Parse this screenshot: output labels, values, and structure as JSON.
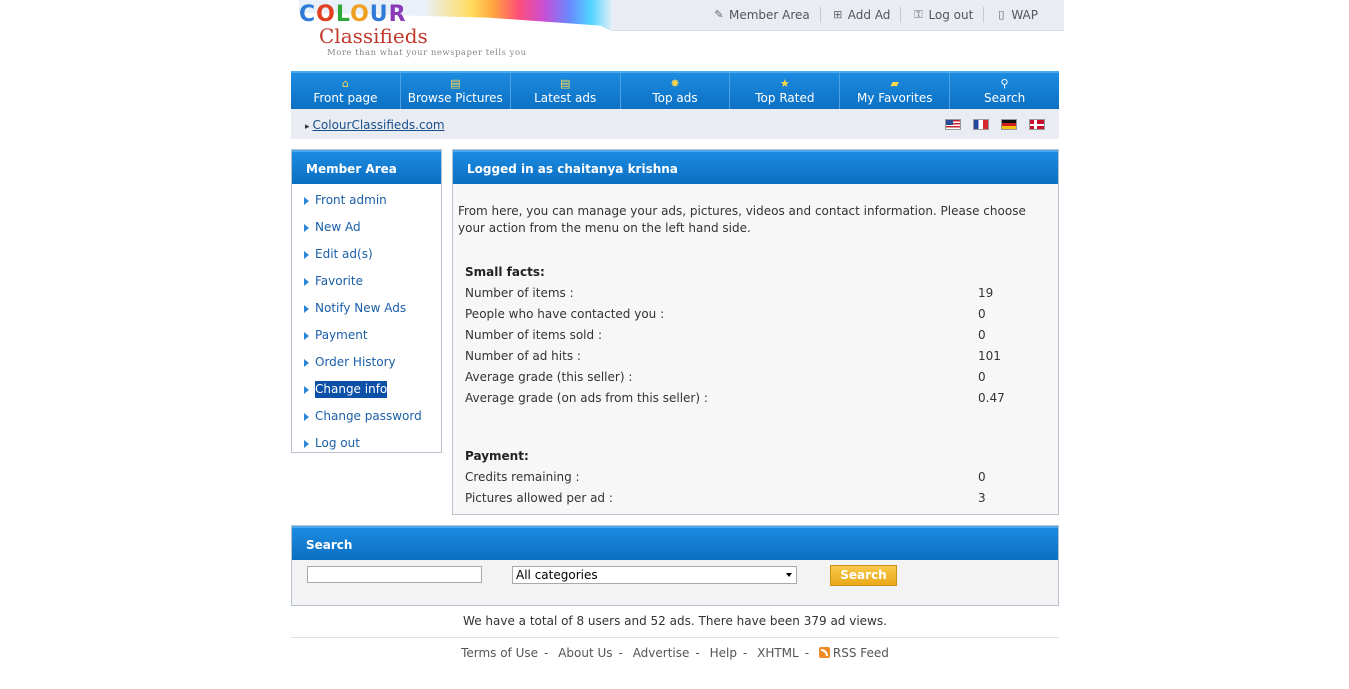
{
  "logo": {
    "colour": [
      "C",
      "O",
      "L",
      "O",
      "U",
      "R"
    ],
    "classifieds": "Classifieds",
    "tagline": "More than what your newspaper tells you"
  },
  "toplinks": [
    {
      "label": "Member Area",
      "icon": "pencil-icon"
    },
    {
      "label": "Add Ad",
      "icon": "add-ad-icon"
    },
    {
      "label": "Log out",
      "icon": "key-icon"
    },
    {
      "label": "WAP",
      "icon": "mobile-icon"
    }
  ],
  "nav": [
    {
      "label": "Front page",
      "icon": "home-icon"
    },
    {
      "label": "Browse Pictures",
      "icon": "pictures-icon"
    },
    {
      "label": "Latest ads",
      "icon": "latest-icon"
    },
    {
      "label": "Top ads",
      "icon": "burst-icon"
    },
    {
      "label": "Top Rated",
      "icon": "star-icon"
    },
    {
      "label": "My Favorites",
      "icon": "folder-icon"
    },
    {
      "label": "Search",
      "icon": "magnifier-icon"
    }
  ],
  "breadcrumb": {
    "link": "ColourClassifieds.com"
  },
  "languages": [
    "us-flag",
    "fr-flag",
    "de-flag",
    "no-flag"
  ],
  "side": {
    "title": "Member Area",
    "items": [
      {
        "label": "Front admin"
      },
      {
        "label": "New Ad"
      },
      {
        "label": "Edit ad(s)"
      },
      {
        "label": "Favorite"
      },
      {
        "label": "Notify New Ads"
      },
      {
        "label": "Payment"
      },
      {
        "label": "Order History"
      },
      {
        "label": "Change info",
        "selected": true
      },
      {
        "label": "Change password"
      },
      {
        "label": "Log out"
      }
    ]
  },
  "main": {
    "title": "Logged in as chaitanya krishna",
    "intro": "From here, you can manage your ads, pictures, videos and contact information. Please choose your action from the menu on the left hand side.",
    "facts_title": "Small facts:",
    "facts": [
      {
        "label": "Number of items :",
        "value": "19"
      },
      {
        "label": "People who have contacted you :",
        "value": "0"
      },
      {
        "label": "Number of items sold :",
        "value": "0"
      },
      {
        "label": "Number of ad hits :",
        "value": "101"
      },
      {
        "label": "Average grade (this seller) :",
        "value": "0"
      },
      {
        "label": "Average grade (on ads from this seller) :",
        "value": "0.47"
      }
    ],
    "payment_title": "Payment:",
    "payment": [
      {
        "label": "Credits remaining :",
        "value": "0"
      },
      {
        "label": "Pictures allowed per ad :",
        "value": "3"
      }
    ]
  },
  "search": {
    "title": "Search",
    "query": "",
    "category": "All categories",
    "button": "Search"
  },
  "stats": "We have a total of 8 users and 52 ads. There have been 379 ad views.",
  "footer": {
    "links": [
      "Terms of Use",
      "About Us",
      "Advertise",
      "Help",
      "XHTML",
      "RSS Feed"
    ]
  }
}
